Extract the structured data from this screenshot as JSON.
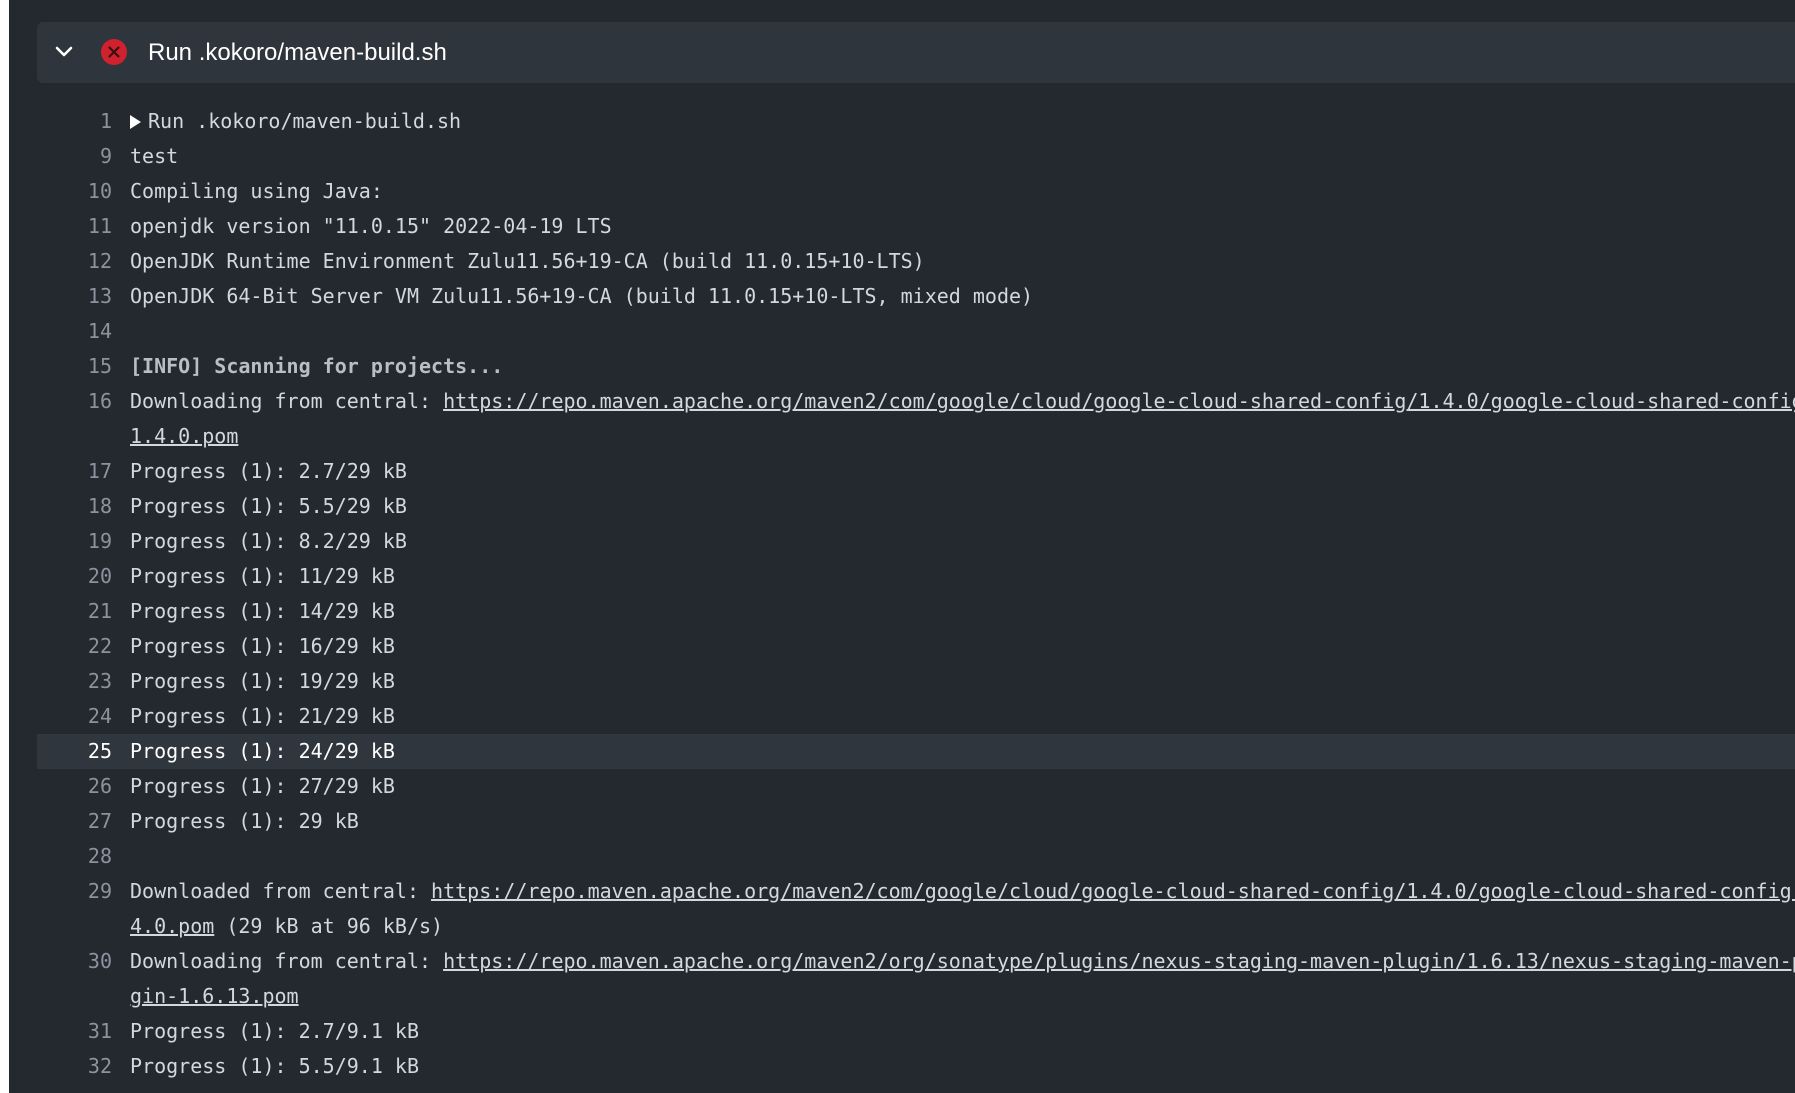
{
  "step": {
    "title": "Run .kokoro/maven-build.sh",
    "status_icon": "error-x-circle-icon",
    "status_color": "#cf222e",
    "collapse_icon": "chevron-down-icon"
  },
  "lines": [
    {
      "num": "1",
      "prefix": "Run .kokoro/maven-build.sh",
      "expandable": true
    },
    {
      "num": "9",
      "prefix": "test"
    },
    {
      "num": "10",
      "prefix": "Compiling using Java:"
    },
    {
      "num": "11",
      "prefix": "openjdk version \"11.0.15\" 2022-04-19 LTS"
    },
    {
      "num": "12",
      "prefix": "OpenJDK Runtime Environment Zulu11.56+19-CA (build 11.0.15+10-LTS)"
    },
    {
      "num": "13",
      "prefix": "OpenJDK 64-Bit Server VM Zulu11.56+19-CA (build 11.0.15+10-LTS, mixed mode)"
    },
    {
      "num": "14",
      "prefix": ""
    },
    {
      "num": "15",
      "prefix": "[INFO] Scanning for projects...",
      "bold": true
    },
    {
      "num": "16",
      "prefix": "Downloading from central: ",
      "link": "https://repo.maven.apache.org/maven2/com/google/cloud/google-cloud-shared-config/1.4.0/google-cloud-shared-config-1.4.0.pom"
    },
    {
      "num": "17",
      "prefix": "Progress (1): 2.7/29 kB"
    },
    {
      "num": "18",
      "prefix": "Progress (1): 5.5/29 kB"
    },
    {
      "num": "19",
      "prefix": "Progress (1): 8.2/29 kB"
    },
    {
      "num": "20",
      "prefix": "Progress (1): 11/29 kB"
    },
    {
      "num": "21",
      "prefix": "Progress (1): 14/29 kB"
    },
    {
      "num": "22",
      "prefix": "Progress (1): 16/29 kB"
    },
    {
      "num": "23",
      "prefix": "Progress (1): 19/29 kB"
    },
    {
      "num": "24",
      "prefix": "Progress (1): 21/29 kB"
    },
    {
      "num": "25",
      "prefix": "Progress (1): 24/29 kB",
      "highlight": true
    },
    {
      "num": "26",
      "prefix": "Progress (1): 27/29 kB"
    },
    {
      "num": "27",
      "prefix": "Progress (1): 29 kB"
    },
    {
      "num": "28",
      "prefix": ""
    },
    {
      "num": "29",
      "prefix": "Downloaded from central: ",
      "link": "https://repo.maven.apache.org/maven2/com/google/cloud/google-cloud-shared-config/1.4.0/google-cloud-shared-config-1.4.0.pom",
      "suffix": " (29 kB at 96 kB/s)"
    },
    {
      "num": "30",
      "prefix": "Downloading from central: ",
      "link": "https://repo.maven.apache.org/maven2/org/sonatype/plugins/nexus-staging-maven-plugin/1.6.13/nexus-staging-maven-plugin-1.6.13.pom"
    },
    {
      "num": "31",
      "prefix": "Progress (1): 2.7/9.1 kB"
    },
    {
      "num": "32",
      "prefix": "Progress (1): 5.5/9.1 kB"
    }
  ]
}
